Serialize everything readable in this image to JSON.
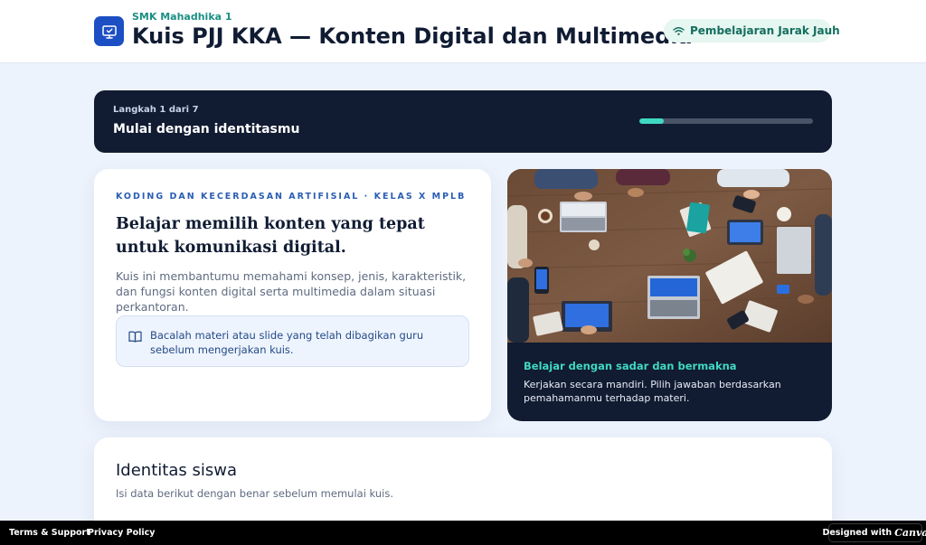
{
  "header": {
    "school": "SMK Mahadhika 1",
    "title": "Kuis PJJ KKA — Konten Digital dan Multimedia",
    "badge": "Pembelajaran Jarak Jauh",
    "logo_icon": "monitor-icon",
    "badge_icon": "wifi-icon"
  },
  "step": {
    "count": "Langkah 1 dari 7",
    "title": "Mulai dengan identitasmu",
    "progress": 0.14
  },
  "intro": {
    "eyebrow": "KODING DAN KECERDASAN ARTIFISIAL · KELAS X MPLB",
    "headline": "Belajar memilih konten yang tepat untuk komunikasi digital.",
    "description": "Kuis ini membantumu memahami konsep, jenis, karakteristik, dan fungsi konten digital serta multimedia dalam situasi perkantoran.",
    "note": "Bacalah materi atau slide yang telah dibagikan guru sebelum mengerjakan kuis.",
    "note_icon": "book-open-icon"
  },
  "image_card": {
    "caption_title": "Belajar dengan sadar dan bermakna",
    "caption_text": "Kerjakan secara mandiri. Pilih jawaban berdasarkan pemahamanmu terhadap materi."
  },
  "identity": {
    "title": "Identitas siswa",
    "subtitle": "Isi data berikut dengan benar sebelum memulai kuis."
  },
  "footer": {
    "terms": "Terms & Support",
    "privacy": "Privacy Policy",
    "designed_with": "Designed with",
    "canva": "Canva"
  },
  "colors": {
    "brand_blue": "#1d4fc4",
    "teal_accent": "#3fd9c3",
    "navy": "#111b31",
    "page_bg": "#edf3fc"
  }
}
